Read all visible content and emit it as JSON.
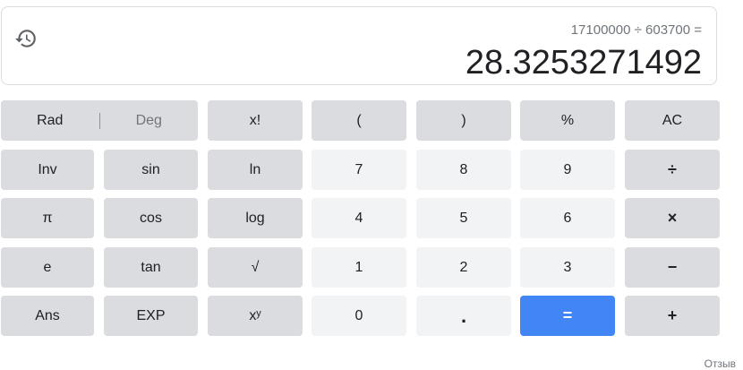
{
  "display": {
    "expression": "17100000 ÷ 603700 =",
    "result": "28.3253271492",
    "history_icon": "history-icon"
  },
  "keys": {
    "rad": "Rad",
    "deg": "Deg",
    "factorial": "x!",
    "open_paren": "(",
    "close_paren": ")",
    "percent": "%",
    "ac": "AC",
    "inv": "Inv",
    "sin": "sin",
    "ln": "ln",
    "seven": "7",
    "eight": "8",
    "nine": "9",
    "divide": "÷",
    "pi": "π",
    "cos": "cos",
    "log": "log",
    "four": "4",
    "five": "5",
    "six": "6",
    "multiply": "×",
    "e": "e",
    "tan": "tan",
    "sqrt": "√",
    "one": "1",
    "two": "2",
    "three": "3",
    "minus": "−",
    "ans": "Ans",
    "exp": "EXP",
    "power": "xʸ",
    "zero": "0",
    "dot": ".",
    "equals": "=",
    "plus": "+"
  },
  "footer": {
    "feedback": "Отзыв"
  },
  "colors": {
    "function_key": "#dadce0",
    "number_key": "#f1f3f4",
    "equals_key": "#4285f4",
    "text": "#202124",
    "muted_text": "#70757a"
  }
}
